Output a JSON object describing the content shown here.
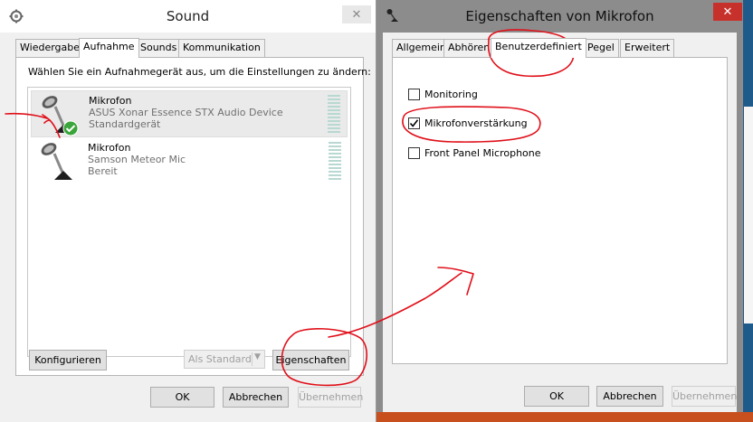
{
  "sound_window": {
    "title": "Sound",
    "tabs": [
      "Wiedergabe",
      "Aufnahme",
      "Sounds",
      "Kommunikation"
    ],
    "active_tab": "Aufnahme",
    "instruction": "Wählen Sie ein Aufnahmegerät aus, um die Einstellungen zu ändern:",
    "devices": [
      {
        "name": "Mikrofon",
        "device": "ASUS Xonar Essence STX Audio Device",
        "status": "Standardgerät",
        "selected": true,
        "default": true
      },
      {
        "name": "Mikrofon",
        "device": "Samson Meteor Mic",
        "status": "Bereit",
        "selected": false,
        "default": false
      }
    ],
    "configure_label": "Konfigurieren",
    "set_default_label": "Als Standard",
    "properties_label": "Eigenschaften",
    "ok_label": "OK",
    "cancel_label": "Abbrechen",
    "apply_label": "Übernehmen"
  },
  "mic_window": {
    "title": "Eigenschaften von Mikrofon",
    "tabs": [
      "Allgemein",
      "Abhören",
      "Benutzerdefiniert",
      "Pegel",
      "Erweitert"
    ],
    "active_tab": "Benutzerdefiniert",
    "options": [
      {
        "label": "Monitoring",
        "checked": false
      },
      {
        "label": "Mikrofonverstärkung",
        "checked": true
      },
      {
        "label": "Front Panel Microphone",
        "checked": false
      }
    ],
    "ok_label": "OK",
    "cancel_label": "Abbrechen",
    "apply_label": "Übernehmen"
  },
  "colors": {
    "annotation": "#e0101a",
    "close_active": "#c7312c",
    "window_frame": "#707070"
  }
}
